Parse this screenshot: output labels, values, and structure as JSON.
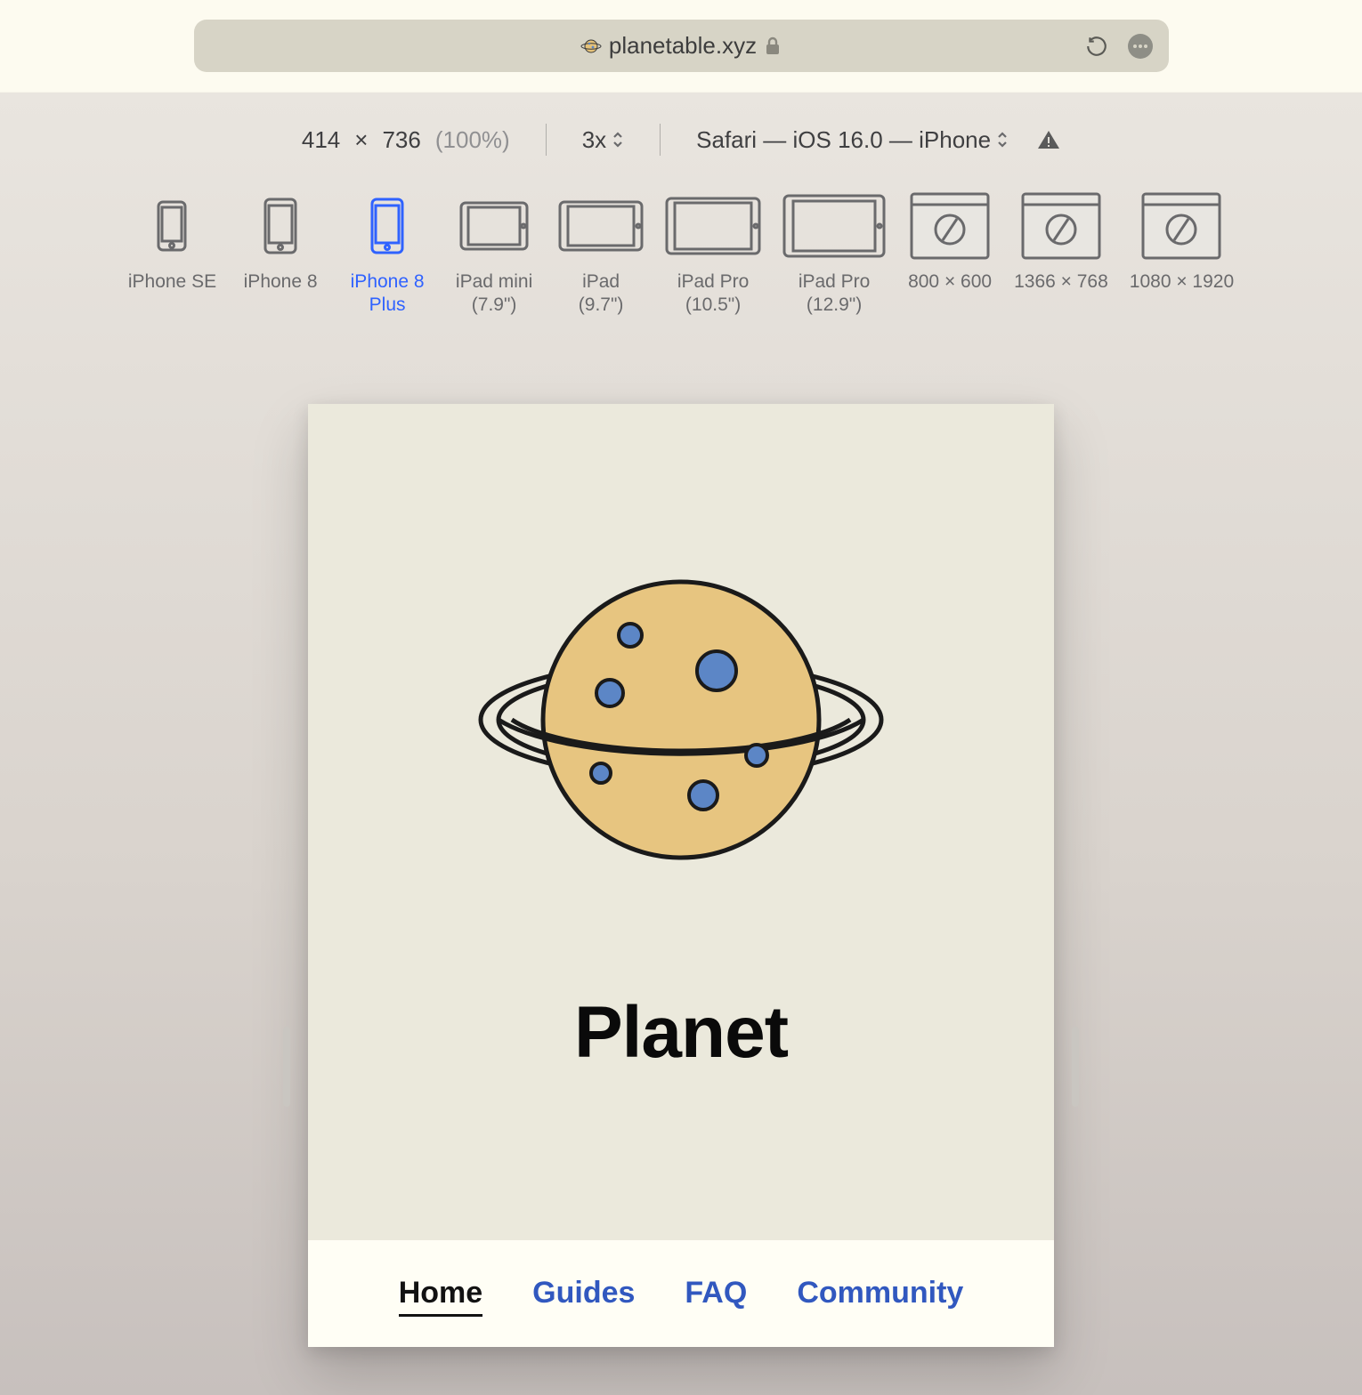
{
  "toolbar": {
    "url": "planetable.xyz"
  },
  "rdm": {
    "width": "414",
    "times": "×",
    "height": "736",
    "zoom": "(100%)",
    "scale": "3x",
    "user_agent": "Safari — iOS 16.0 — iPhone"
  },
  "devices": [
    {
      "label": "iPhone SE",
      "kind": "phone-small"
    },
    {
      "label": "iPhone 8",
      "kind": "phone"
    },
    {
      "label": "iPhone 8\nPlus",
      "kind": "phone",
      "active": true
    },
    {
      "label": "iPad mini\n(7.9\")",
      "kind": "tablet-portrait-small"
    },
    {
      "label": "iPad\n(9.7\")",
      "kind": "tablet-landscape-small"
    },
    {
      "label": "iPad Pro\n(10.5\")",
      "kind": "tablet-landscape"
    },
    {
      "label": "iPad Pro\n(12.9\")",
      "kind": "tablet-landscape-large"
    },
    {
      "label": "800 × 600",
      "kind": "browser"
    },
    {
      "label": "1366 × 768",
      "kind": "browser"
    },
    {
      "label": "1080 × 1920",
      "kind": "browser"
    }
  ],
  "page": {
    "title": "Planet",
    "nav": [
      {
        "label": "Home",
        "active": true
      },
      {
        "label": "Guides"
      },
      {
        "label": "FAQ"
      },
      {
        "label": "Community"
      }
    ]
  }
}
